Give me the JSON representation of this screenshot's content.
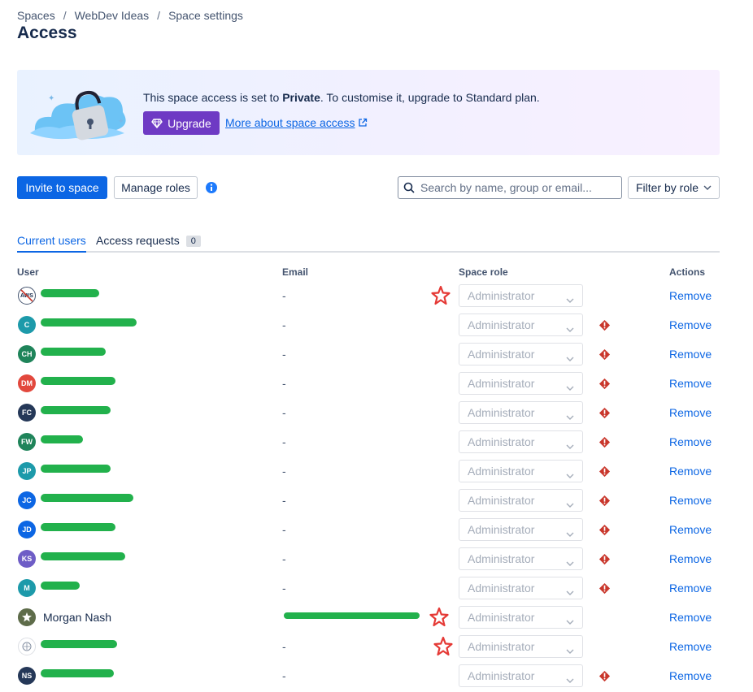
{
  "breadcrumb": [
    "Spaces",
    "WebDev Ideas",
    "Space settings"
  ],
  "page_title": "Access",
  "banner": {
    "text_before": "This space access is set to ",
    "text_bold": "Private",
    "text_after": ". To customise it, upgrade to Standard plan.",
    "upgrade_label": "Upgrade",
    "link_label": "More about space access"
  },
  "toolbar": {
    "invite_label": "Invite to space",
    "manage_roles_label": "Manage roles",
    "search_placeholder": "Search by name, group or email...",
    "filter_label": "Filter by role"
  },
  "tabs": {
    "current_users": "Current users",
    "access_requests": "Access requests",
    "access_requests_count": "0"
  },
  "table": {
    "headers": {
      "user": "User",
      "email": "Email",
      "role": "Space role",
      "actions": "Actions"
    },
    "rows": [
      {
        "initials": "AWS",
        "avatar_color": "#ffffff",
        "name": "",
        "email": "-",
        "role": "Administrator",
        "warning": false,
        "star": true,
        "action": "Remove"
      },
      {
        "initials": "C",
        "avatar_color": "#1d9aaa",
        "name": "",
        "email": "-",
        "role": "Administrator",
        "warning": true,
        "star": false,
        "action": "Remove"
      },
      {
        "initials": "CH",
        "avatar_color": "#1f845a",
        "name": "",
        "email": "-",
        "role": "Administrator",
        "warning": true,
        "star": false,
        "action": "Remove"
      },
      {
        "initials": "DM",
        "avatar_color": "#e2483d",
        "name": "",
        "email": "-",
        "role": "Administrator",
        "warning": true,
        "star": false,
        "action": "Remove"
      },
      {
        "initials": "FC",
        "avatar_color": "#253858",
        "name": "",
        "email": "-",
        "role": "Administrator",
        "warning": true,
        "star": false,
        "action": "Remove"
      },
      {
        "initials": "FW",
        "avatar_color": "#1f845a",
        "name": "",
        "email": "-",
        "role": "Administrator",
        "warning": true,
        "star": false,
        "action": "Remove"
      },
      {
        "initials": "JP",
        "avatar_color": "#1d9aaa",
        "name": "",
        "email": "-",
        "role": "Administrator",
        "warning": true,
        "star": false,
        "action": "Remove"
      },
      {
        "initials": "JC",
        "avatar_color": "#0c66e4",
        "name": "",
        "email": "-",
        "role": "Administrator",
        "warning": true,
        "star": false,
        "action": "Remove"
      },
      {
        "initials": "JD",
        "avatar_color": "#0c66e4",
        "name": "",
        "email": "-",
        "role": "Administrator",
        "warning": true,
        "star": false,
        "action": "Remove"
      },
      {
        "initials": "KS",
        "avatar_color": "#6e5dc6",
        "name": "",
        "email": "-",
        "role": "Administrator",
        "warning": true,
        "star": false,
        "action": "Remove"
      },
      {
        "initials": "M",
        "avatar_color": "#1d9aaa",
        "name": "",
        "email": "-",
        "role": "Administrator",
        "warning": true,
        "star": false,
        "action": "Remove"
      },
      {
        "initials": "",
        "avatar_color": "#5e6c4a",
        "name": "Morgan Nash",
        "email": "",
        "role": "Administrator",
        "warning": false,
        "star": true,
        "action": "Remove"
      },
      {
        "initials": "",
        "avatar_color": "#ffffff",
        "name": "",
        "email": "-",
        "role": "Administrator",
        "warning": false,
        "star": true,
        "action": "Remove"
      },
      {
        "initials": "NS",
        "avatar_color": "#253858",
        "name": "",
        "email": "-",
        "role": "Administrator",
        "warning": true,
        "star": false,
        "action": "Remove"
      }
    ]
  },
  "colors": {
    "primary": "#0c66e4",
    "upgrade": "#6e3ac4",
    "warning": "#c9372c",
    "redaction": "#22b14c",
    "star_annotation": "#e53935"
  }
}
